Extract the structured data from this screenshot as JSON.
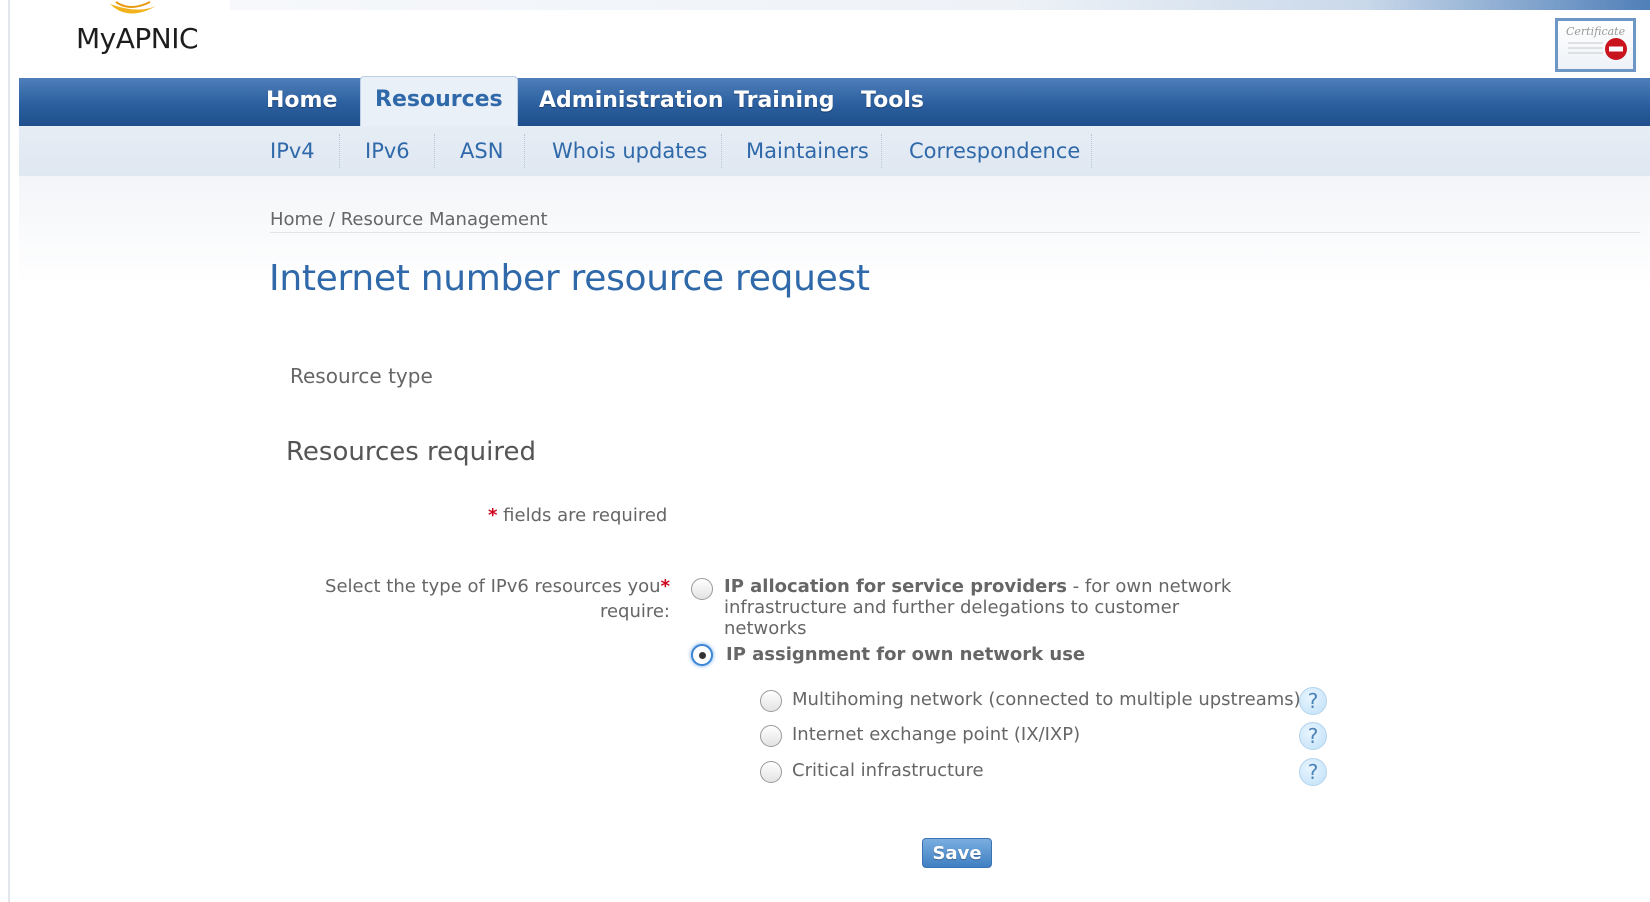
{
  "app": {
    "logo_text": "MyAPNIC"
  },
  "nav": {
    "items": [
      {
        "label": "Home"
      },
      {
        "label": "Resources"
      },
      {
        "label": "Administration"
      },
      {
        "label": "Training"
      },
      {
        "label": "Tools"
      }
    ],
    "active": "Resources"
  },
  "subnav": {
    "items": [
      {
        "label": "IPv4"
      },
      {
        "label": "IPv6"
      },
      {
        "label": "ASN"
      },
      {
        "label": "Whois updates"
      },
      {
        "label": "Maintainers"
      },
      {
        "label": "Correspondence"
      }
    ]
  },
  "breadcrumb": {
    "home": "Home",
    "separator": "/",
    "current": "Resource Management"
  },
  "page": {
    "title": "Internet number resource request",
    "resource_type_label": "Resource type",
    "section_heading": "Resources required"
  },
  "form": {
    "required_note_star": "*",
    "required_note": "fields are required",
    "question_line1": "Select the type of IPv6 resources you",
    "question_line2": "require:",
    "question_star": "*",
    "options": [
      {
        "bold": "IP allocation for service providers",
        "rest_line1": " - for own network",
        "rest_line2": "infrastructure and further delegations to customer networks",
        "selected": false
      },
      {
        "bold": "IP assignment for own network use",
        "selected": true
      }
    ],
    "sub_options": [
      {
        "label": "Multihoming network (connected to multiple upstreams)",
        "selected": false,
        "help": "?"
      },
      {
        "label": "Internet exchange point (IX/IXP)",
        "selected": false,
        "help": "?"
      },
      {
        "label": "Critical infrastructure",
        "selected": false,
        "help": "?"
      }
    ],
    "save_label": "Save"
  },
  "colors": {
    "nav_blue": "#2b5f9f",
    "link_blue": "#2f69a9",
    "required_red": "#d0021b"
  },
  "icons": {
    "certificate": "certificate-icon",
    "help": "help-icon"
  }
}
